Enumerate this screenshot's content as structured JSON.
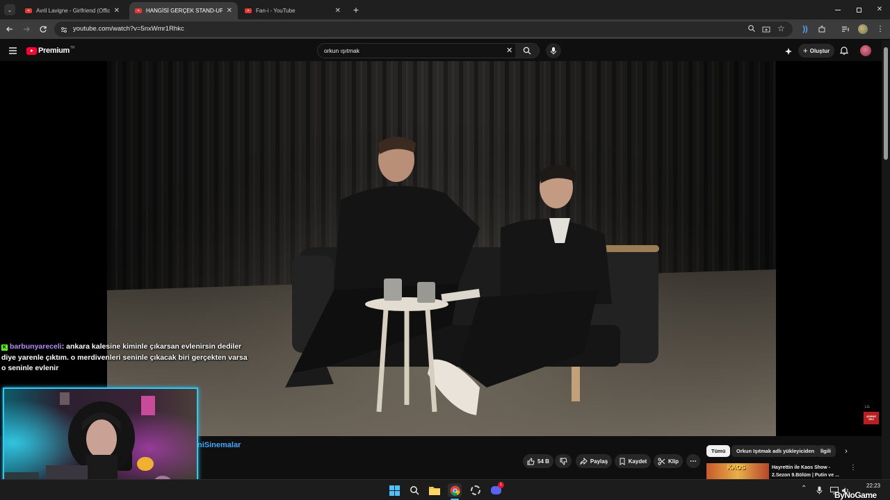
{
  "browser": {
    "tabs": [
      {
        "title": "Avril Lavigne - Girlfriend (Official",
        "active": false
      },
      {
        "title": "HANGİSİ GERÇEK STAND-UP KO",
        "active": true
      },
      {
        "title": "Fan-i - YouTube",
        "active": false
      }
    ],
    "new_tab_icon": "plus-icon",
    "url": "youtube.com/watch?v=5nxWmr1Rhkc"
  },
  "youtube": {
    "logo_text": "Premium",
    "region": "TR",
    "search_value": "orkun ışıtmak",
    "create_label": "Oluştur"
  },
  "chat": {
    "username": "barbunyareceli",
    "message": ": ankara kalesine kiminle çıkarsan evlenirsin dediler diye yarenle çıktım. o merdivenleri seninle çıkacak biri gerçekten varsa o seninle evlenir"
  },
  "video_overlay": {
    "corner_badge": "ADENE SEZ"
  },
  "below_video": {
    "channel_name_partial": "niSinemalar",
    "like_count": "54 B",
    "share_label": "Paylaş",
    "save_label": "Kaydet",
    "clip_label": "Klip",
    "chips": [
      "Tümü",
      "Orkun Işıtmak adlı yükleyiciden",
      "İlgili"
    ],
    "recommended_title_line1": "Hayrettin ile Kaos Show -",
    "recommended_title_line2": "2.Sezon 9.Bölüm | Putin ve ...",
    "thumbnail_text": "KAOS"
  },
  "taskbar": {
    "time": "22:23",
    "watermark": "ByNoGame",
    "discord_badge": "1"
  },
  "colors": {
    "webcam_border": "#37c8f0",
    "username_color": "#b58cf5",
    "youtube_red": "#ff0033"
  }
}
